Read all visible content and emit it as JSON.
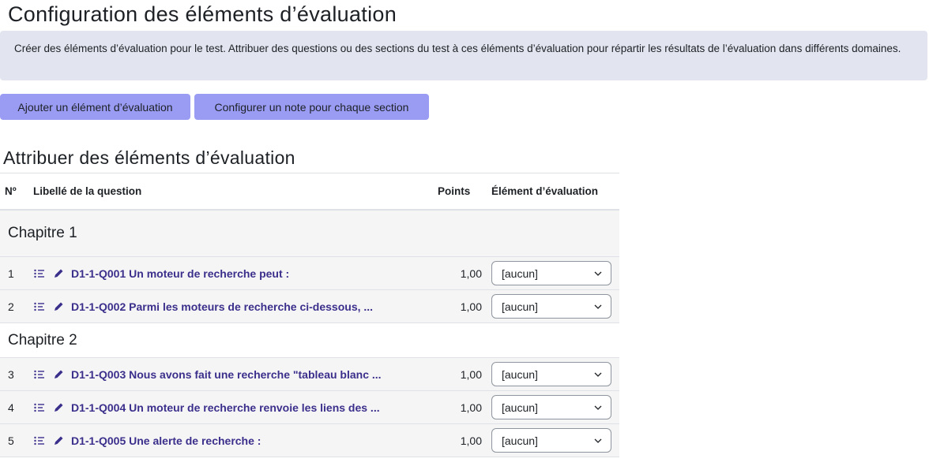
{
  "page": {
    "title": "Configuration des éléments d’évaluation",
    "info": "Créer des éléments d’évaluation pour le test. Attribuer des questions ou des sections du test à ces éléments d’évaluation pour répartir les résultats de l’évaluation dans différents domaines."
  },
  "buttons": {
    "add": "Ajouter un élément d’évaluation",
    "config": "Configurer un note pour chaque section"
  },
  "section": {
    "title": "Attribuer des éléments d’évaluation"
  },
  "table": {
    "headers": {
      "num": "Nº",
      "label": "Libellé de la question",
      "points": "Points",
      "element": "Élément d’évaluation"
    },
    "chapters": [
      {
        "title": "Chapitre 1"
      },
      {
        "title": "Chapitre 2"
      }
    ],
    "rows": [
      {
        "num": "1",
        "label": "D1-1-Q001 Un moteur de recherche peut :",
        "points": "1,00",
        "element": "[aucun]"
      },
      {
        "num": "2",
        "label": "D1-1-Q002 Parmi les moteurs de recherche ci-dessous, ...",
        "points": "1,00",
        "element": "[aucun]"
      },
      {
        "num": "3",
        "label": "D1-1-Q003 Nous avons fait une recherche \"tableau blanc ...",
        "points": "1,00",
        "element": "[aucun]"
      },
      {
        "num": "4",
        "label": "D1-1-Q004 Un moteur de recherche renvoie les liens des ...",
        "points": "1,00",
        "element": "[aucun]"
      },
      {
        "num": "5",
        "label": "D1-1-Q005 Une alerte de recherche :",
        "points": "1,00",
        "element": "[aucun]"
      }
    ]
  },
  "colors": {
    "accent": "#9a9cf4",
    "link": "#3b2f8c",
    "info_bg": "#e2e4ef"
  }
}
